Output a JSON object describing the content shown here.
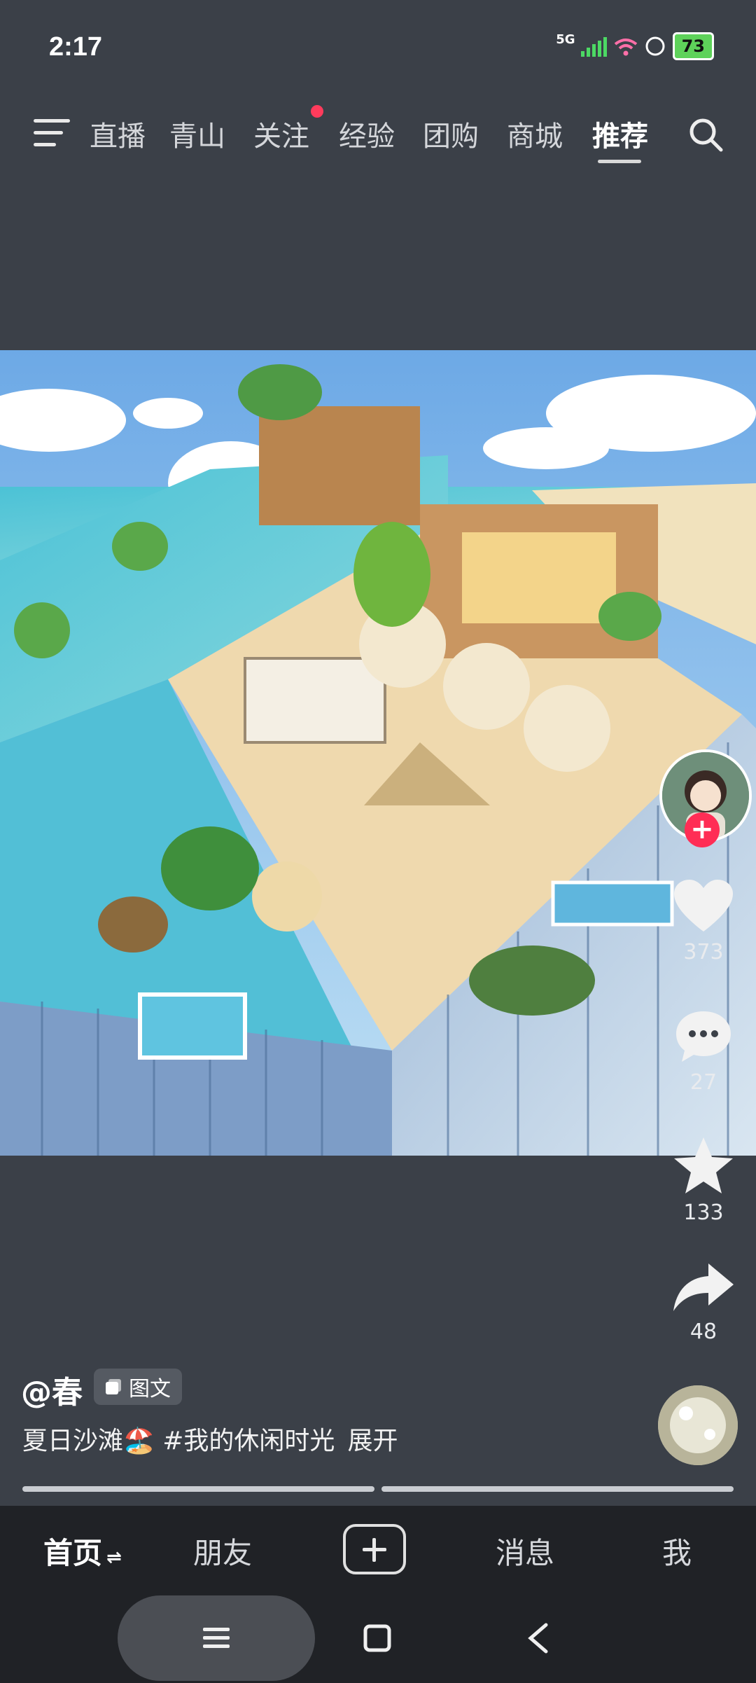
{
  "status": {
    "time": "2:17",
    "network": "5G",
    "battery": "73"
  },
  "top_tabs": [
    {
      "label": "直播"
    },
    {
      "label": "青山"
    },
    {
      "label": "关注"
    },
    {
      "label": "经验"
    },
    {
      "label": "团购"
    },
    {
      "label": "商城"
    },
    {
      "label": "推荐"
    }
  ],
  "active_tab": "推荐",
  "actions": {
    "likes": "373",
    "comments": "27",
    "favorites": "133",
    "shares": "48"
  },
  "post": {
    "author": "@春",
    "type_badge": "图文",
    "caption": "夏日沙滩🏖️ #我的休闲时光",
    "expand_label": "展开",
    "image_page": 1,
    "image_count": 2
  },
  "bottom_tabs": {
    "home": "首页",
    "friends": "朋友",
    "messages": "消息",
    "me": "我"
  },
  "colors": {
    "accent": "#ff2d55",
    "background": "#3b4048",
    "tabbar": "#202226"
  }
}
